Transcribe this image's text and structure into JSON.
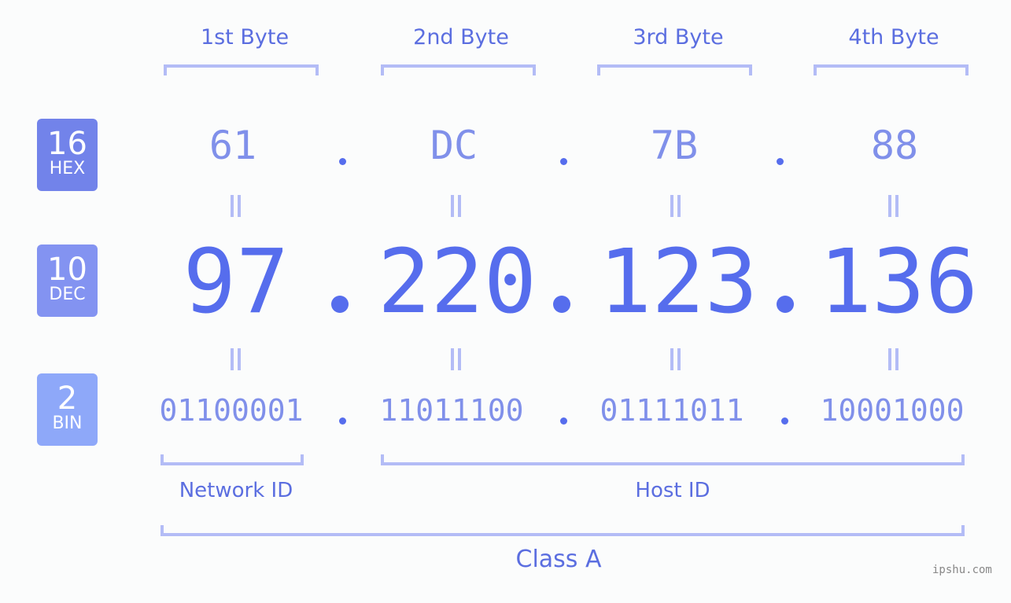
{
  "byte_headers": [
    "1st Byte",
    "2nd Byte",
    "3rd Byte",
    "4th Byte"
  ],
  "badges": {
    "hex": {
      "num": "16",
      "label": "HEX",
      "color": "#7283ea"
    },
    "dec": {
      "num": "10",
      "label": "DEC",
      "color": "#8393f1"
    },
    "bin": {
      "num": "2",
      "label": "BIN",
      "color": "#8ea8f9"
    }
  },
  "ip": {
    "hex": [
      "61",
      "DC",
      "7B",
      "88"
    ],
    "dec": [
      "97",
      "220",
      "123",
      "136"
    ],
    "bin": [
      "01100001",
      "11011100",
      "01111011",
      "10001000"
    ],
    "separator": "."
  },
  "sections": {
    "network_id": "Network ID",
    "host_id": "Host ID",
    "ip_class": "Class A"
  },
  "watermark": "ipshu.com",
  "colors": {
    "accent": "#566ded",
    "label": "#5b6ee0",
    "bracket": "#b3bcf6",
    "secondary_value": "#8090ea"
  }
}
